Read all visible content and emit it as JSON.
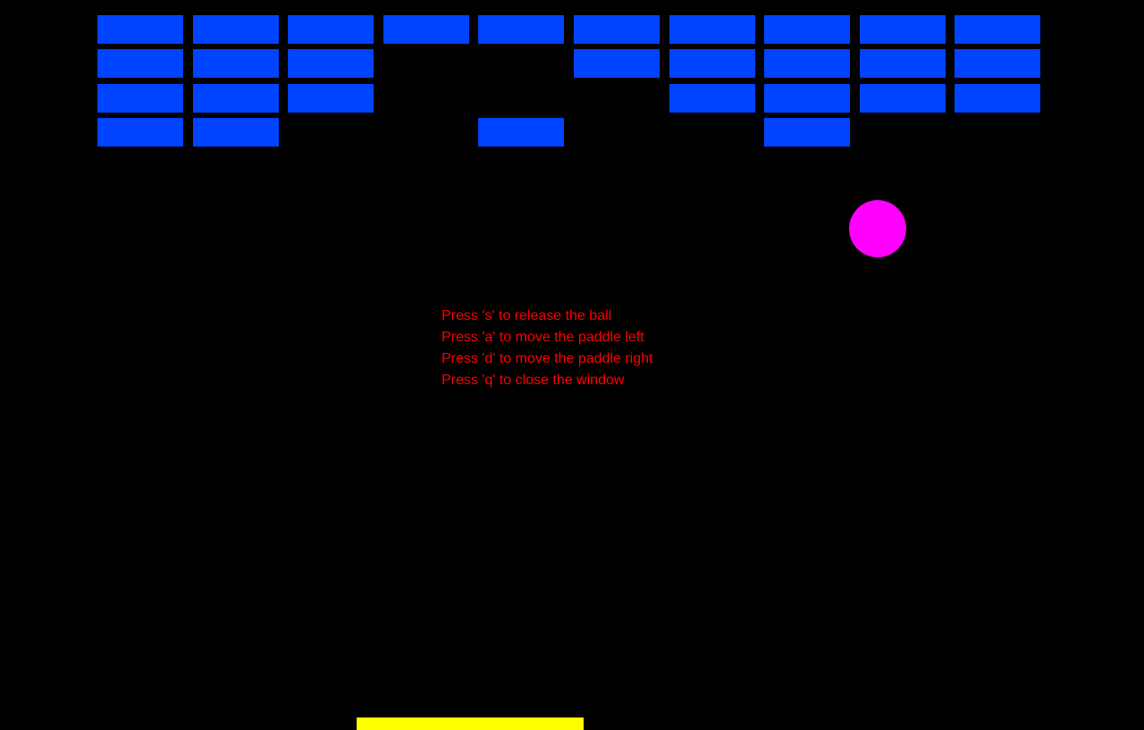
{
  "colors": {
    "background": "#000000",
    "brick": "#0044ff",
    "ball": "#ff00ff",
    "paddle": "#ffff00",
    "instruction_text": "#ff0000"
  },
  "bricks": {
    "columns": 10,
    "rows": 4,
    "present": [
      [
        1,
        1,
        1,
        1,
        1,
        1,
        1,
        1,
        1,
        1
      ],
      [
        1,
        1,
        1,
        0,
        0,
        1,
        1,
        1,
        1,
        1
      ],
      [
        1,
        1,
        1,
        0,
        0,
        0,
        1,
        1,
        1,
        1
      ],
      [
        1,
        1,
        0,
        0,
        1,
        0,
        0,
        1,
        0,
        0
      ]
    ]
  },
  "instructions": [
    "Press 's' to release the ball",
    "Press 'a' to move the paddle left",
    "Press 'd' to move the paddle right",
    "Press 'q' to close the window"
  ]
}
